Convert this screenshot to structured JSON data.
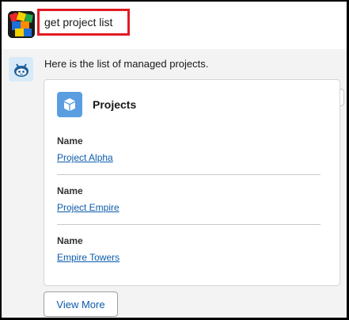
{
  "user": {
    "query": "get project list",
    "avatar_icon": "colorful-cube-logo-icon"
  },
  "bot": {
    "avatar_icon": "bot-face-icon",
    "message": "Here is the list of managed projects."
  },
  "feedback": {
    "thumbs_up_icon": "thumbs-up-icon",
    "thumbs_down_icon": "thumbs-down-icon"
  },
  "card": {
    "icon": "cube-icon",
    "title": "Projects",
    "records": [
      {
        "label": "Name",
        "value": "Project Alpha"
      },
      {
        "label": "Name",
        "value": "Project Empire"
      },
      {
        "label": "Name",
        "value": "Empire Towers"
      }
    ]
  },
  "actions": {
    "view_more_label": "View More"
  },
  "colors": {
    "query_border": "#e21b23",
    "link": "#0b5cab",
    "card_icon_bg": "#5a9de0",
    "bot_area_bg": "#f3f3f3"
  }
}
